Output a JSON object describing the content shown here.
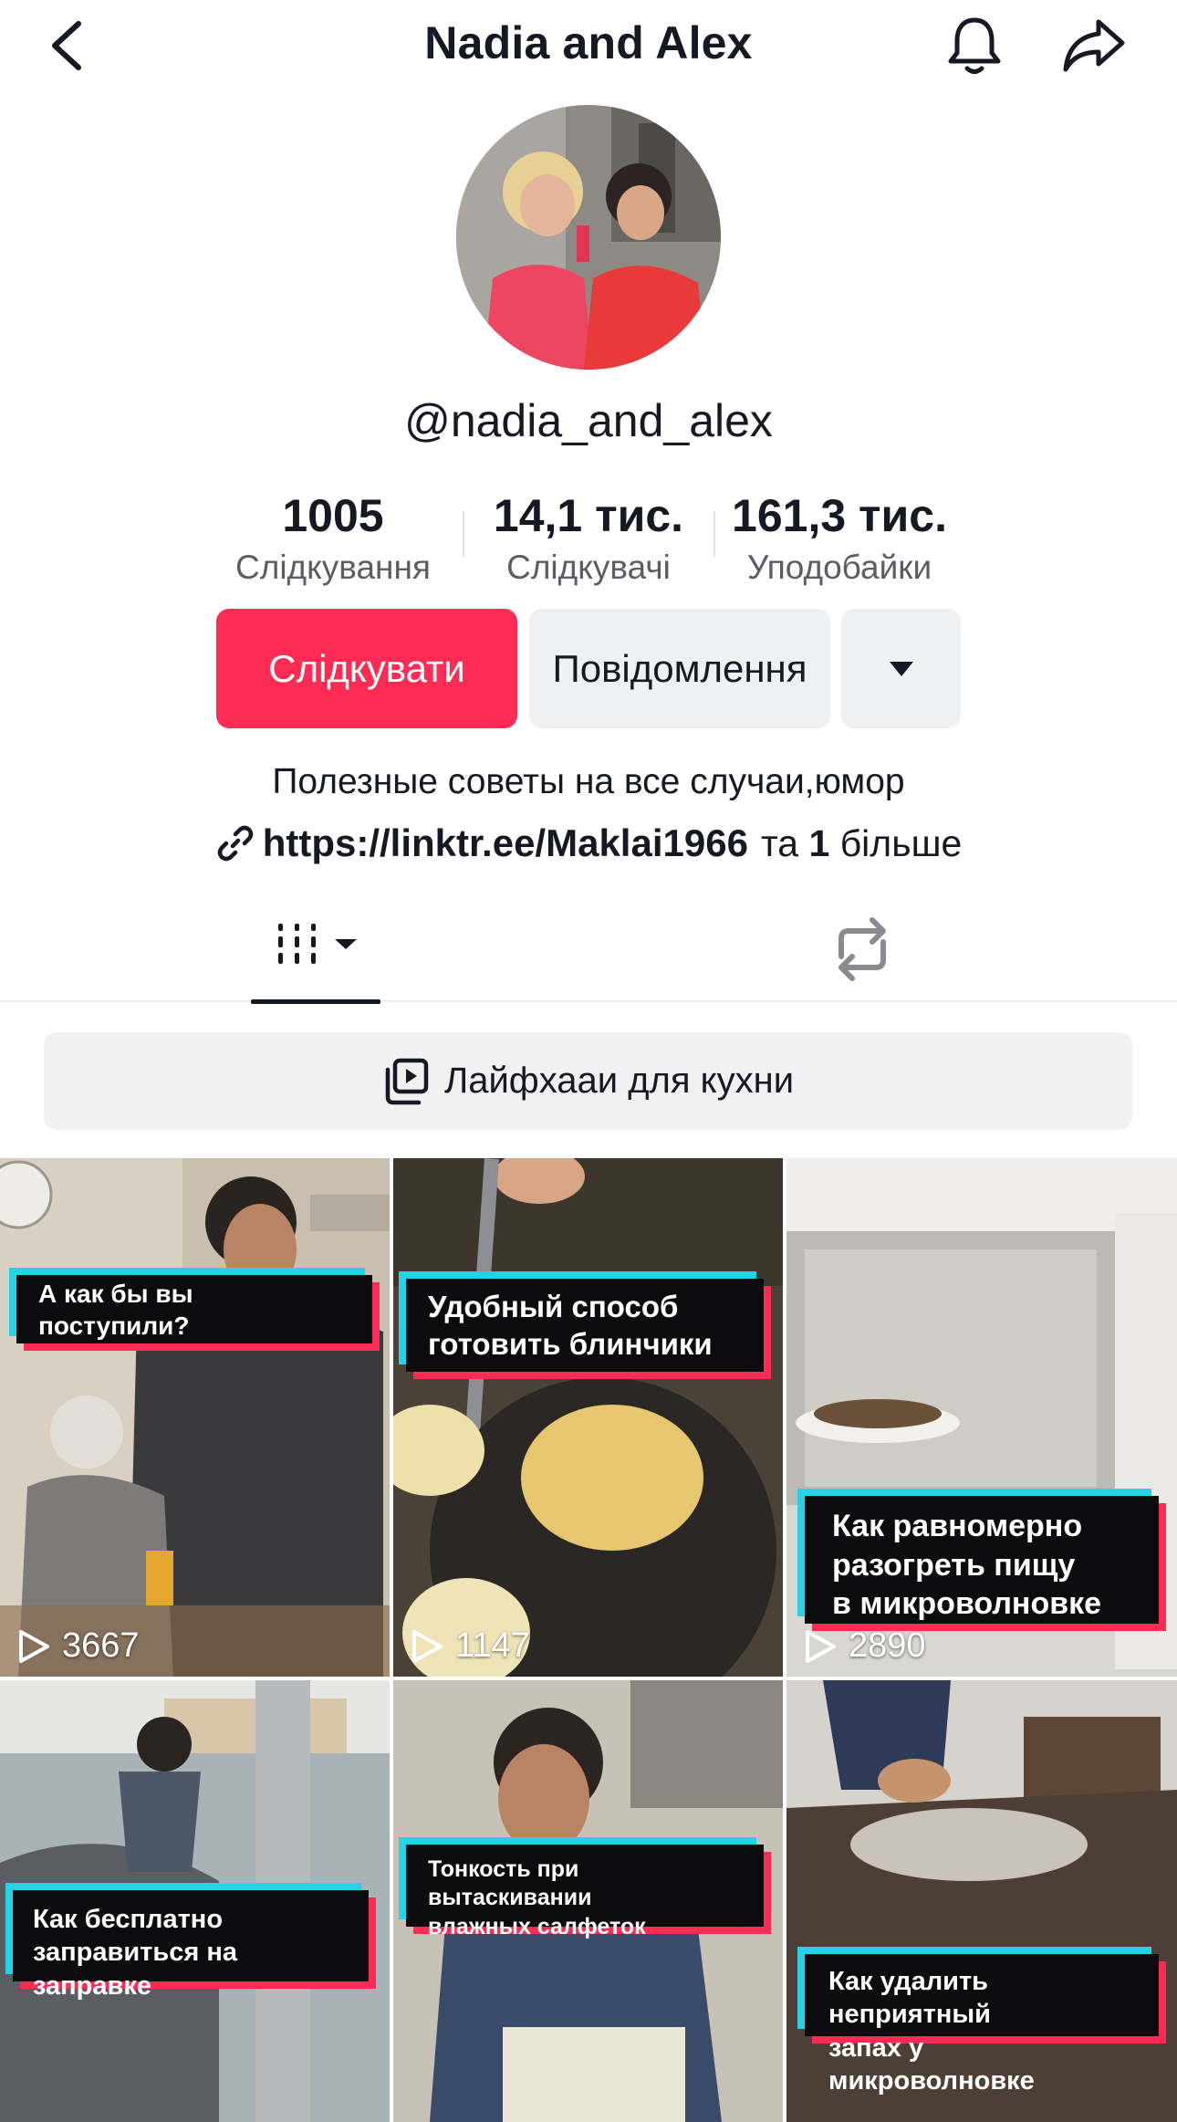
{
  "header": {
    "title": "Nadia and Alex"
  },
  "profile": {
    "handle": "@nadia_and_alex",
    "stats": [
      {
        "value": "1005",
        "label": "Слідкування"
      },
      {
        "value": "14,1 тис.",
        "label": "Слідкувачі"
      },
      {
        "value": "161,3 тис.",
        "label": "Уподобайки"
      }
    ],
    "follow_label": "Слідкувати",
    "message_label": "Повідомлення",
    "bio": "Полезные советы на все случаи,юмор",
    "link_url": "https://linktr.ee/Maklai1966",
    "link_more_prefix": "та",
    "link_more_count": "1",
    "link_more_suffix": "більше"
  },
  "playlist": {
    "label": "Лайфхааи для кухни"
  },
  "videos": [
    {
      "caption_lines": [
        "А как бы вы поступили?"
      ],
      "views": "3667"
    },
    {
      "caption_lines": [
        "Удобный способ",
        "готовить блинчики"
      ],
      "views": "1147"
    },
    {
      "caption_lines": [
        "Как равномерно",
        "разогреть пищу",
        "в микроволновке"
      ],
      "views": "2890"
    },
    {
      "caption_lines": [
        "Как бесплатно",
        "заправиться на заправке"
      ]
    },
    {
      "caption_lines": [
        "Тонкость при вытаскивании",
        "влажных салфеток"
      ]
    },
    {
      "caption_lines": [
        "Как удалить неприятный",
        "запах у микроволновке"
      ]
    }
  ],
  "colors": {
    "accent": "#fe2c55",
    "caption_cyan": "#25d3e6",
    "button_grey": "#eef0f2"
  },
  "icons": {
    "back": "chevron-left-icon",
    "notifications": "bell-icon",
    "share": "share-arrow-icon",
    "more": "caret-down-icon",
    "link": "link-icon",
    "videos_tab": "grid-columns-icon",
    "reposts_tab": "repost-icon",
    "playlist": "playlist-icon",
    "views": "play-icon"
  }
}
